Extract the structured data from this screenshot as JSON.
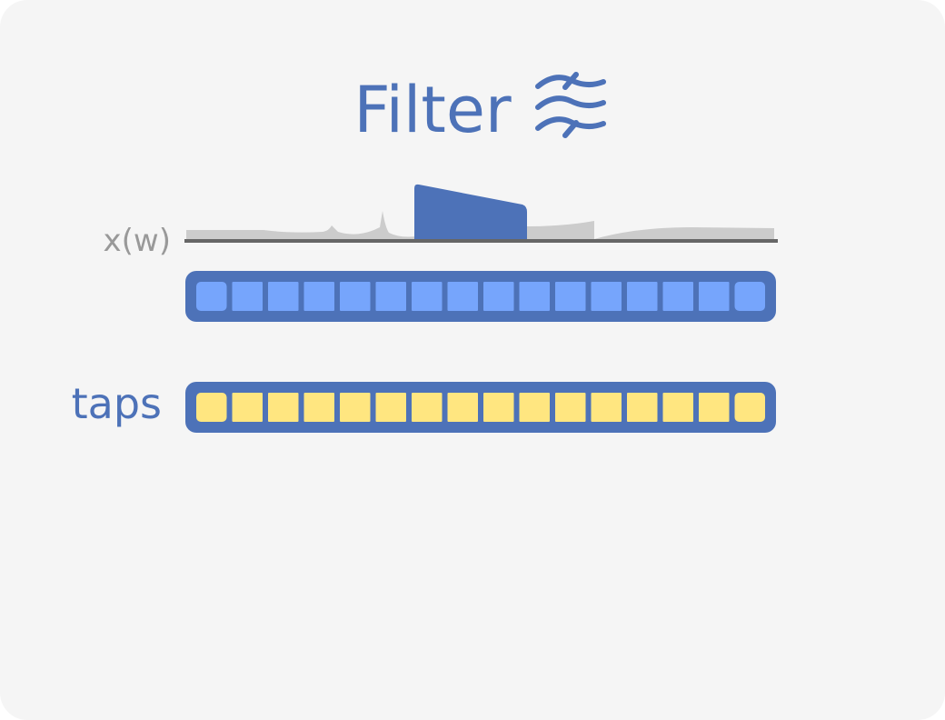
{
  "title": "Filter",
  "title_icon": "filter-waves-icon",
  "signal_label": "x(w)",
  "taps_label": "taps",
  "input_buffer": {
    "cell_count": 16,
    "cell_color": "#76a5fc"
  },
  "taps_buffer": {
    "cell_count": 16,
    "cell_color": "#ffe680"
  },
  "colors": {
    "accent": "#4d72b8",
    "spectrum": "#cccccc",
    "axis": "#666666",
    "label_gray": "#999999"
  }
}
